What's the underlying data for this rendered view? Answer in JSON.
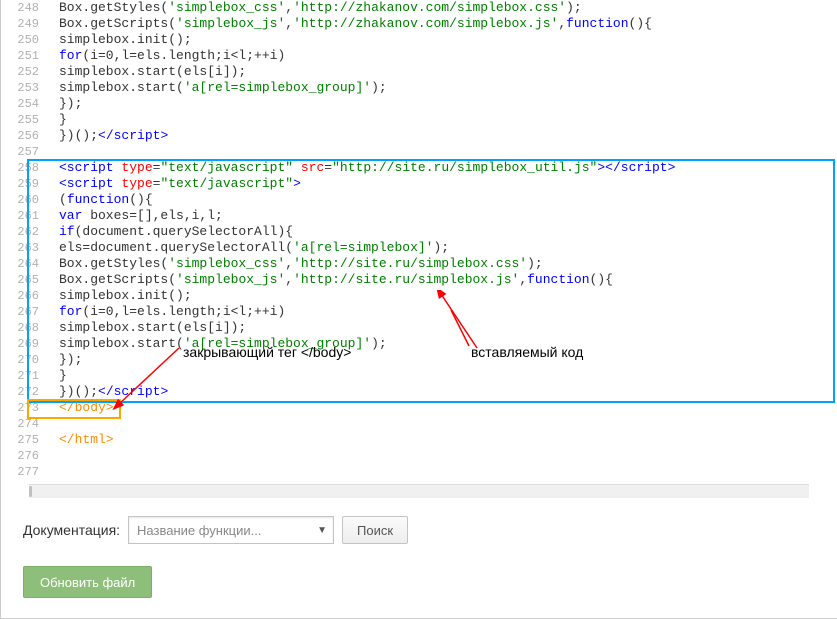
{
  "lines": [
    {
      "num": "248",
      "tokens": [
        {
          "cls": "s-plain",
          "t": "Box.getStyles("
        },
        {
          "cls": "s-string",
          "t": "'simplebox_css'"
        },
        {
          "cls": "s-plain",
          "t": ","
        },
        {
          "cls": "s-string",
          "t": "'http://zhakanov.com/simplebox.css'"
        },
        {
          "cls": "s-plain",
          "t": ");"
        }
      ]
    },
    {
      "num": "249",
      "tokens": [
        {
          "cls": "s-plain",
          "t": "Box.getScripts("
        },
        {
          "cls": "s-string",
          "t": "'simplebox_js'"
        },
        {
          "cls": "s-plain",
          "t": ","
        },
        {
          "cls": "s-string",
          "t": "'http://zhakanov.com/simplebox.js'"
        },
        {
          "cls": "s-plain",
          "t": ","
        },
        {
          "cls": "s-keyword",
          "t": "function"
        },
        {
          "cls": "s-plain",
          "t": "(){"
        }
      ]
    },
    {
      "num": "250",
      "tokens": [
        {
          "cls": "s-plain",
          "t": "simplebox.init();"
        }
      ]
    },
    {
      "num": "251",
      "tokens": [
        {
          "cls": "s-keyword",
          "t": "for"
        },
        {
          "cls": "s-plain",
          "t": "(i=0,l=els.length;i<l;++i)"
        }
      ]
    },
    {
      "num": "252",
      "tokens": [
        {
          "cls": "s-plain",
          "t": "simplebox.start(els[i]);"
        }
      ]
    },
    {
      "num": "253",
      "tokens": [
        {
          "cls": "s-plain",
          "t": "simplebox.start("
        },
        {
          "cls": "s-string",
          "t": "'a[rel=simplebox_group]'"
        },
        {
          "cls": "s-plain",
          "t": ");"
        }
      ]
    },
    {
      "num": "254",
      "tokens": [
        {
          "cls": "s-plain",
          "t": "});"
        }
      ]
    },
    {
      "num": "255",
      "tokens": [
        {
          "cls": "s-plain",
          "t": "}"
        }
      ]
    },
    {
      "num": "256",
      "tokens": [
        {
          "cls": "s-plain",
          "t": "})();"
        },
        {
          "cls": "s-tag",
          "t": "</script"
        },
        {
          "cls": "s-tag",
          "t": ">"
        }
      ]
    },
    {
      "num": "257",
      "tokens": []
    },
    {
      "num": "258",
      "tokens": [
        {
          "cls": "s-tag",
          "t": "<script "
        },
        {
          "cls": "s-attr",
          "t": "type"
        },
        {
          "cls": "s-plain",
          "t": "="
        },
        {
          "cls": "s-string",
          "t": "\"text/javascript\""
        },
        {
          "cls": "s-attr",
          "t": " src"
        },
        {
          "cls": "s-plain",
          "t": "="
        },
        {
          "cls": "s-string",
          "t": "\"http://site.ru/simplebox_util.js\""
        },
        {
          "cls": "s-tag",
          "t": ">"
        },
        {
          "cls": "s-tag",
          "t": "</script"
        },
        {
          "cls": "s-tag",
          "t": ">"
        }
      ]
    },
    {
      "num": "259",
      "tokens": [
        {
          "cls": "s-tag",
          "t": "<script "
        },
        {
          "cls": "s-attr",
          "t": "type"
        },
        {
          "cls": "s-plain",
          "t": "="
        },
        {
          "cls": "s-string",
          "t": "\"text/javascript\""
        },
        {
          "cls": "s-tag",
          "t": ">"
        }
      ]
    },
    {
      "num": "260",
      "tokens": [
        {
          "cls": "s-plain",
          "t": "("
        },
        {
          "cls": "s-keyword",
          "t": "function"
        },
        {
          "cls": "s-plain",
          "t": "(){"
        }
      ]
    },
    {
      "num": "261",
      "tokens": [
        {
          "cls": "s-var",
          "t": "var"
        },
        {
          "cls": "s-plain",
          "t": " boxes=[],els,i,l;"
        }
      ]
    },
    {
      "num": "262",
      "tokens": [
        {
          "cls": "s-keyword",
          "t": "if"
        },
        {
          "cls": "s-plain",
          "t": "(document.querySelectorAll){"
        }
      ]
    },
    {
      "num": "263",
      "tokens": [
        {
          "cls": "s-plain",
          "t": "els=document.querySelectorAll("
        },
        {
          "cls": "s-string",
          "t": "'a[rel=simplebox]'"
        },
        {
          "cls": "s-plain",
          "t": ");"
        }
      ]
    },
    {
      "num": "264",
      "tokens": [
        {
          "cls": "s-plain",
          "t": "Box.getStyles("
        },
        {
          "cls": "s-string",
          "t": "'simplebox_css'"
        },
        {
          "cls": "s-plain",
          "t": ","
        },
        {
          "cls": "s-string",
          "t": "'http://site.ru/simplebox.css'"
        },
        {
          "cls": "s-plain",
          "t": ");"
        }
      ]
    },
    {
      "num": "265",
      "tokens": [
        {
          "cls": "s-plain",
          "t": "Box.getScripts("
        },
        {
          "cls": "s-string",
          "t": "'simplebox_js'"
        },
        {
          "cls": "s-plain",
          "t": ","
        },
        {
          "cls": "s-string",
          "t": "'http://site.ru/simplebox.js'"
        },
        {
          "cls": "s-plain",
          "t": ","
        },
        {
          "cls": "s-keyword",
          "t": "function"
        },
        {
          "cls": "s-plain",
          "t": "(){"
        }
      ]
    },
    {
      "num": "266",
      "tokens": [
        {
          "cls": "s-plain",
          "t": "simplebox.init();"
        }
      ]
    },
    {
      "num": "267",
      "tokens": [
        {
          "cls": "s-keyword",
          "t": "for"
        },
        {
          "cls": "s-plain",
          "t": "(i=0,l=els.length;i<l;++i)"
        }
      ]
    },
    {
      "num": "268",
      "tokens": [
        {
          "cls": "s-plain",
          "t": "simplebox.start(els[i]);"
        }
      ]
    },
    {
      "num": "269",
      "tokens": [
        {
          "cls": "s-plain",
          "t": "simplebox.start("
        },
        {
          "cls": "s-string",
          "t": "'a[rel=simplebox_group]'"
        },
        {
          "cls": "s-plain",
          "t": ");"
        }
      ]
    },
    {
      "num": "270",
      "tokens": [
        {
          "cls": "s-plain",
          "t": "});"
        }
      ]
    },
    {
      "num": "271",
      "tokens": [
        {
          "cls": "s-plain",
          "t": "}"
        }
      ]
    },
    {
      "num": "272",
      "tokens": [
        {
          "cls": "s-plain",
          "t": "})();"
        },
        {
          "cls": "s-tag",
          "t": "</script"
        },
        {
          "cls": "s-tag",
          "t": ">"
        }
      ]
    },
    {
      "num": "273",
      "tokens": [
        {
          "cls": "s-closing",
          "t": "</body>"
        }
      ]
    },
    {
      "num": "274",
      "tokens": []
    },
    {
      "num": "275",
      "tokens": [
        {
          "cls": "s-closing",
          "t": "</html>"
        }
      ]
    },
    {
      "num": "276",
      "tokens": []
    },
    {
      "num": "277",
      "tokens": []
    }
  ],
  "annotations": {
    "left": "закрывающий тег </body>",
    "right": "вставляемый код"
  },
  "bottom": {
    "label": "Документация:",
    "placeholder": "Название функции...",
    "search": "Поиск",
    "update": "Обновить файл"
  }
}
